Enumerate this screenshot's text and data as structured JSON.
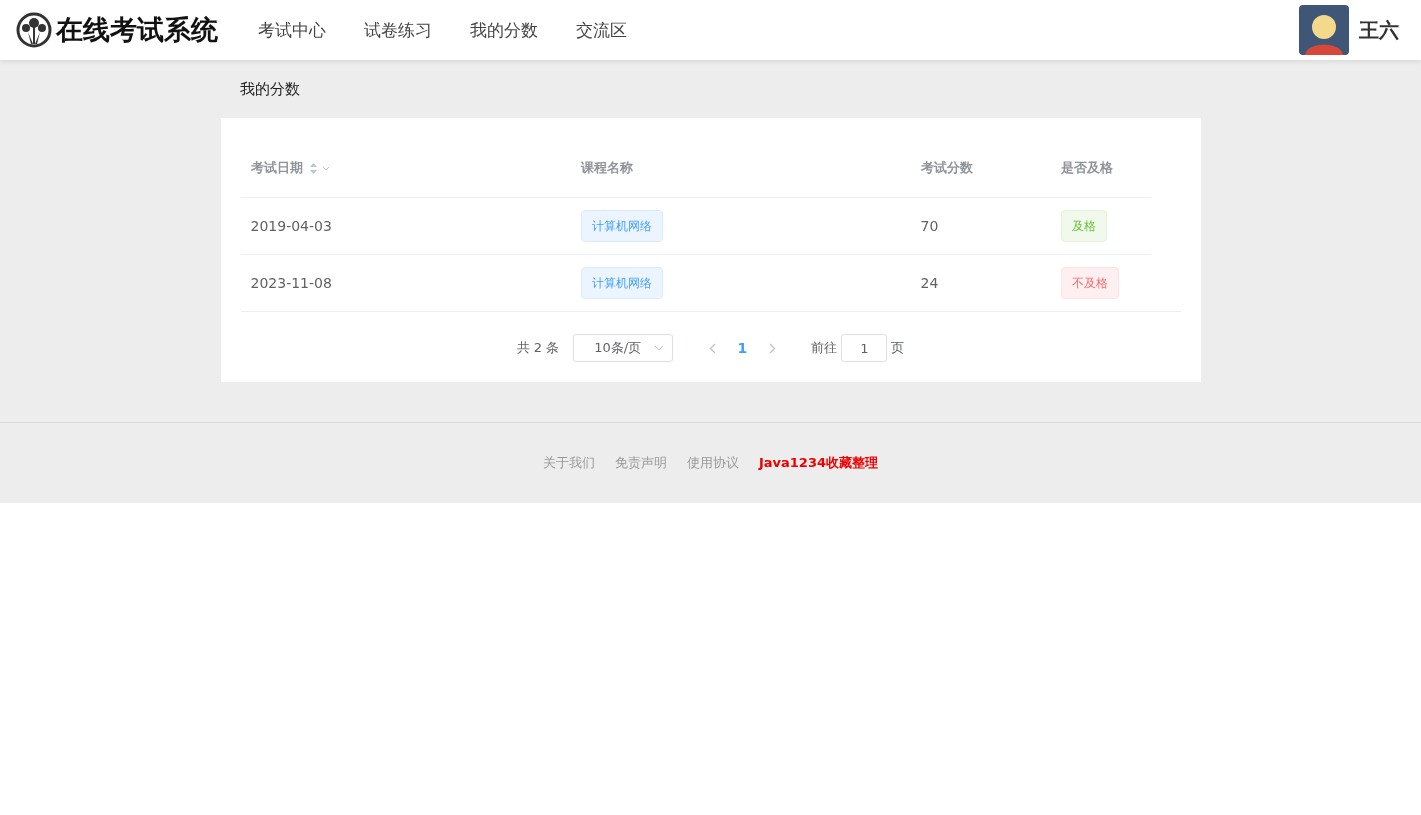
{
  "header": {
    "logo_text": "在线考试系统",
    "nav": [
      {
        "label": "考试中心",
        "selected": false
      },
      {
        "label": "试卷练习",
        "selected": false
      },
      {
        "label": "我的分数",
        "selected": false
      },
      {
        "label": "交流区",
        "selected": false
      }
    ],
    "user_name": "王六"
  },
  "page_title": "我的分数",
  "table": {
    "columns": [
      {
        "label": "考试日期",
        "sortable": true
      },
      {
        "label": "课程名称",
        "sortable": false
      },
      {
        "label": "考试分数",
        "sortable": false
      },
      {
        "label": "是否及格",
        "sortable": false
      }
    ],
    "rows": [
      {
        "date": "2019-04-03",
        "course": "计算机网络",
        "score": "70",
        "result": "及格",
        "passed": true
      },
      {
        "date": "2023-11-08",
        "course": "计算机网络",
        "score": "24",
        "result": "不及格",
        "passed": false
      }
    ]
  },
  "pagination": {
    "total": "共 2 条",
    "page_size": "10条/页",
    "pages": [
      {
        "label": "1",
        "selected": true
      }
    ],
    "goto_label": "前往",
    "goto_value": "1",
    "goto_suffix": "页"
  },
  "footer": {
    "links": [
      {
        "label": "关于我们",
        "highlight": false
      },
      {
        "label": "免责声明",
        "highlight": false
      },
      {
        "label": "使用协议",
        "highlight": false
      },
      {
        "label": "Java1234收藏整理",
        "highlight": true
      }
    ]
  }
}
